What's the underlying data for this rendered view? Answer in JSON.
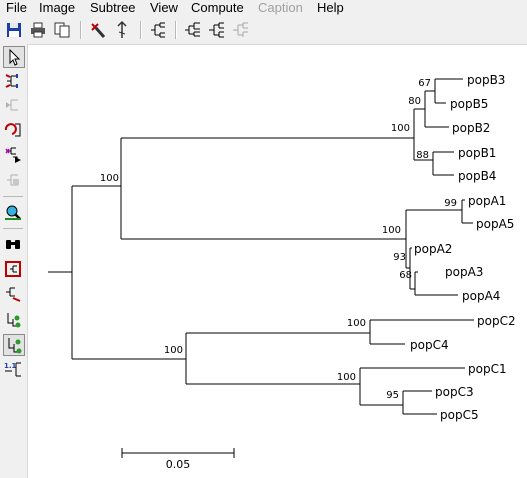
{
  "menu": [
    "File",
    "Image",
    "Subtree",
    "View",
    "Compute",
    "Caption",
    "Help"
  ],
  "menu_disabled": [
    "Caption"
  ],
  "toolbar_icons": [
    "save-icon",
    "print-icon",
    "copy-icon",
    "tools-icon",
    "flip-icon",
    "tree-style-icon",
    "tree-rectangular-icon",
    "tree-slanted-icon",
    "tree-disabled-icon"
  ],
  "left_tools": [
    "pointer-icon",
    "swap-subtree-icon",
    "disabled-tool-icon",
    "compress-subtree-icon",
    "root-icon",
    "disabled-tool-2-icon",
    "search-taxa-icon",
    "find-binoculars-icon",
    "fit-window-icon",
    "subtree-colors-icon",
    "node-info-icon",
    "branch-style-icon",
    "scale-label-icon"
  ],
  "tree": {
    "scale_bar_label": "0.05",
    "taxa": [
      "popB3",
      "popB5",
      "popB2",
      "popB1",
      "popB4",
      "popA1",
      "popA5",
      "popA2",
      "popA3",
      "popA4",
      "popC2",
      "popC4",
      "popC1",
      "popC3",
      "popC5"
    ],
    "bootstrap": [
      "67",
      "80",
      "100",
      "88",
      "100",
      "99",
      "100",
      "93",
      "68",
      "100",
      "100",
      "100",
      "95"
    ]
  }
}
